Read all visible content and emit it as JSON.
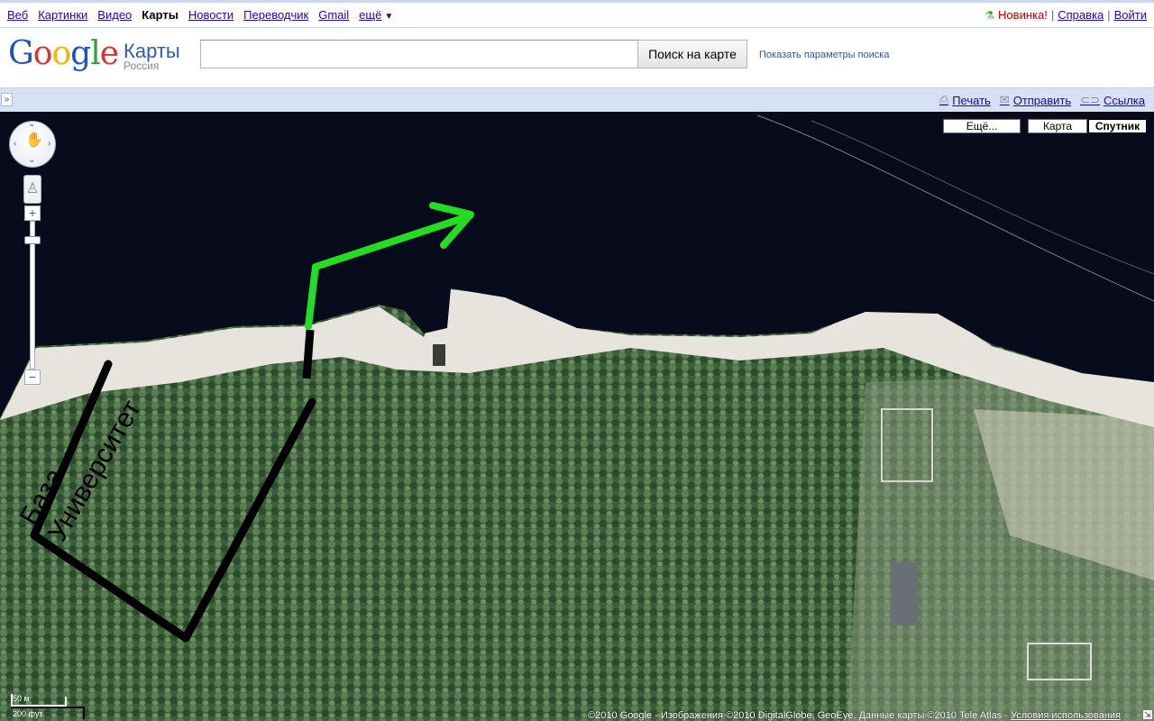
{
  "gbar": {
    "links": [
      {
        "label": "Веб"
      },
      {
        "label": "Картинки"
      },
      {
        "label": "Видео"
      },
      {
        "label": "Карты",
        "current": true
      },
      {
        "label": "Новости"
      },
      {
        "label": "Переводчик"
      },
      {
        "label": "Gmail"
      },
      {
        "label": "ещё"
      }
    ],
    "new_label": "Новинка!",
    "help_label": "Справка",
    "login_label": "Войти"
  },
  "header": {
    "logo_text": "Google",
    "product": "Карты",
    "region": "Россия",
    "search_value": "",
    "search_button": "Поиск на карте",
    "search_options": "Показать параметры поиска"
  },
  "toolbar": {
    "print": "Печать",
    "send": "Отправить",
    "link": "Ссылка"
  },
  "map": {
    "type_buttons": {
      "more": "Ещё...",
      "map": "Карта",
      "satellite": "Спутник",
      "selected": "satellite"
    },
    "annotation_text": "База Университет",
    "scale_metric": "50 м",
    "scale_imperial": "200 фут",
    "copyright": "©2010 Google - Изображения ©2010 DigitalGlobe, GeoEye, Данные карты ©2010 Tele Atlas - ",
    "terms": "Условия использования",
    "colors": {
      "water": "#070b1c",
      "forest": "#3b5a38",
      "sand": "#e8e6df",
      "arrow": "#22dd22",
      "outline": "#000000"
    }
  }
}
